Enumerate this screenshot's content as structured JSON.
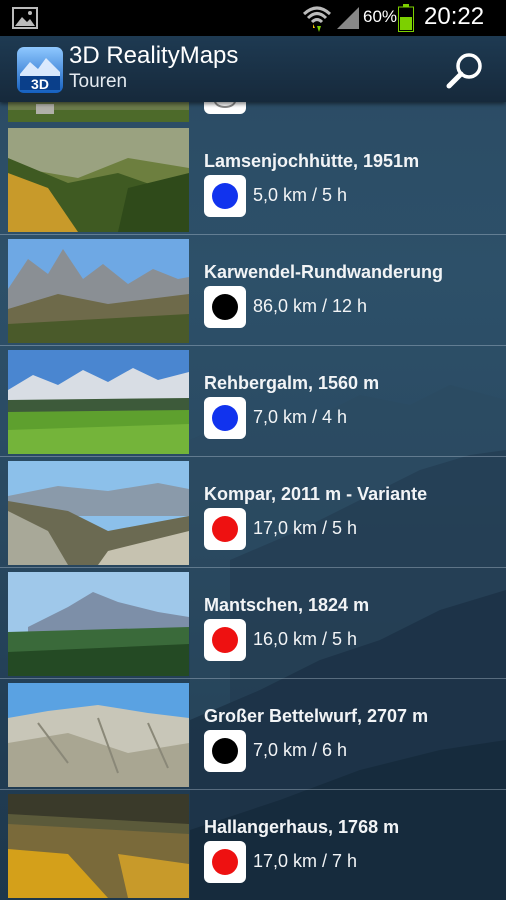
{
  "status_bar": {
    "battery_percent": "60%",
    "time": "20:22"
  },
  "app": {
    "title": "3D RealityMaps",
    "subtitle": "Touren",
    "logo_text": "3D"
  },
  "colors": {
    "blue": "#1133ee",
    "black": "#000000",
    "red": "#ee1111"
  },
  "tours": [
    {
      "name": "Lamsenjochhütte, 1951m",
      "meta": "5,0 km / 5 h",
      "difficulty": "blue",
      "scene": "larch-valley"
    },
    {
      "name": "Karwendel-Rundwanderung",
      "meta": "86,0 km / 12 h",
      "difficulty": "black",
      "scene": "rock-peaks"
    },
    {
      "name": "Rehbergalm, 1560 m",
      "meta": "7,0 km / 4 h",
      "difficulty": "blue",
      "scene": "meadow-range"
    },
    {
      "name": "Kompar, 2011 m - Variante",
      "meta": "17,0 km / 5 h",
      "difficulty": "red",
      "scene": "valley-view"
    },
    {
      "name": "Mantschen, 1824 m",
      "meta": "16,0 km / 5 h",
      "difficulty": "red",
      "scene": "forest-peak"
    },
    {
      "name": "Großer Bettelwurf, 2707 m",
      "meta": "7,0 km / 6 h",
      "difficulty": "black",
      "scene": "limestone-ridge"
    },
    {
      "name": "Hallangerhaus, 1768 m",
      "meta": "17,0 km / 7 h",
      "difficulty": "red",
      "scene": "autumn-slope"
    }
  ]
}
